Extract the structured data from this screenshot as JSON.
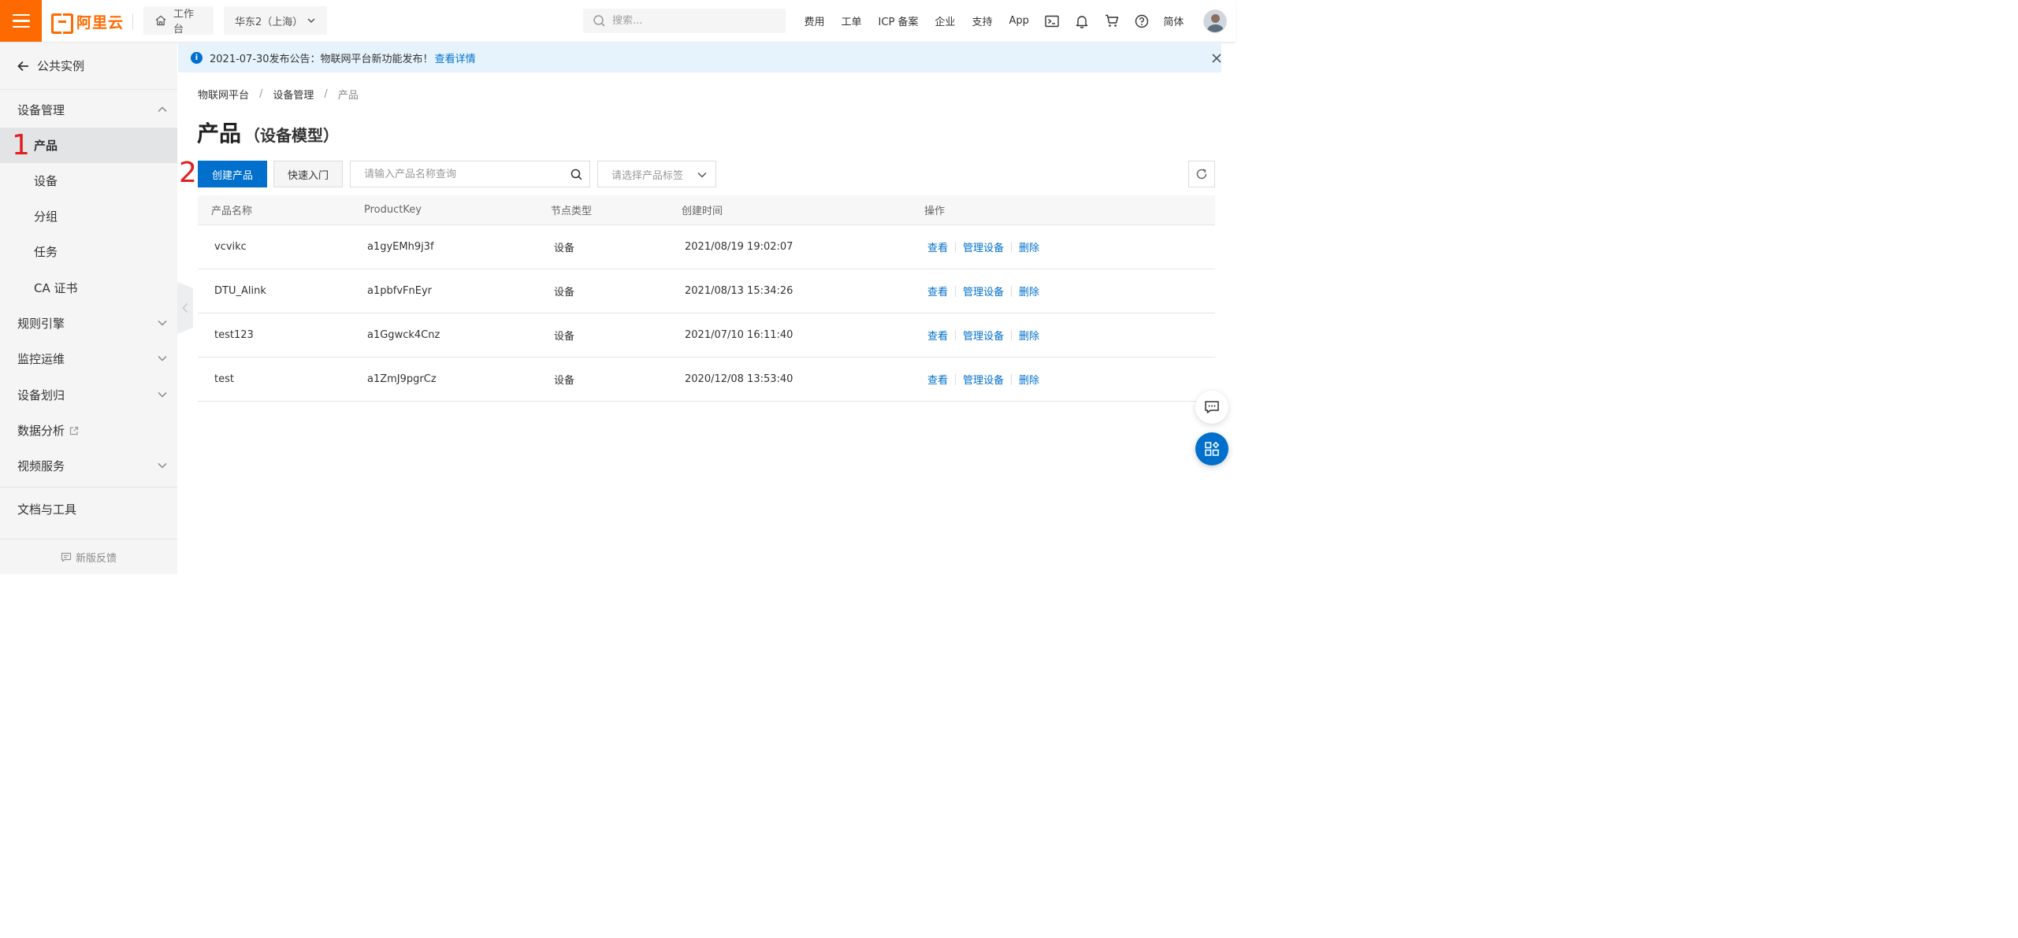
{
  "topbar": {
    "logo_text": "阿里云",
    "workbench_label": "工作台",
    "region_label": "华东2（上海）",
    "search_placeholder": "搜索...",
    "links": [
      "费用",
      "工单",
      "ICP 备案",
      "企业",
      "支持",
      "App"
    ],
    "language_label": "简体",
    "icons": [
      "terminal-icon",
      "bell-icon",
      "cart-icon",
      "help-icon"
    ]
  },
  "sidebar": {
    "back_label": "公共实例",
    "groups": [
      {
        "label": "设备管理",
        "expanded": true,
        "items": [
          "产品",
          "设备",
          "分组",
          "任务",
          "CA 证书"
        ],
        "active_item": "产品"
      },
      {
        "label": "规则引擎",
        "expanded": false
      },
      {
        "label": "监控运维",
        "expanded": false
      },
      {
        "label": "设备划归",
        "expanded": false
      },
      {
        "label": "数据分析",
        "external": true
      },
      {
        "label": "视频服务",
        "expanded": false
      }
    ],
    "docs_label": "文档与工具",
    "feedback_label": "新版反馈"
  },
  "annotations": {
    "step1": "1",
    "step2": "2",
    "color": "#e02020"
  },
  "notice": {
    "text": "2021-07-30发布公告：物联网平台新功能发布！",
    "link_text": "查看详情"
  },
  "breadcrumb": [
    "物联网平台",
    "设备管理",
    "产品"
  ],
  "page": {
    "title": "产品",
    "subtitle": "（设备模型）"
  },
  "toolbar": {
    "create_label": "创建产品",
    "quickstart_label": "快速入门",
    "query_placeholder": "请输入产品名称查询",
    "tag_placeholder": "请选择产品标签"
  },
  "table": {
    "headers": [
      "产品名称",
      "ProductKey",
      "节点类型",
      "创建时间",
      "操作"
    ],
    "rows": [
      {
        "name": "vcvikc",
        "key": "a1gyEMh9j3f",
        "node": "设备",
        "created": "2021/08/19 19:02:07"
      },
      {
        "name": "DTU_Alink",
        "key": "a1pbfvFnEyr",
        "node": "设备",
        "created": "2021/08/13 15:34:26"
      },
      {
        "name": "test123",
        "key": "a1Ggwck4Cnz",
        "node": "设备",
        "created": "2021/07/10 16:11:40"
      },
      {
        "name": "test",
        "key": "a1ZmJ9pgrCz",
        "node": "设备",
        "created": "2020/12/08 13:53:40"
      }
    ],
    "actions": [
      "查看",
      "管理设备",
      "删除"
    ]
  },
  "colors": {
    "brand": "#ff6a00",
    "primary": "#0070cc",
    "sidebar_bg": "#f5f5f6",
    "notice_bg": "#e6f3fc"
  }
}
